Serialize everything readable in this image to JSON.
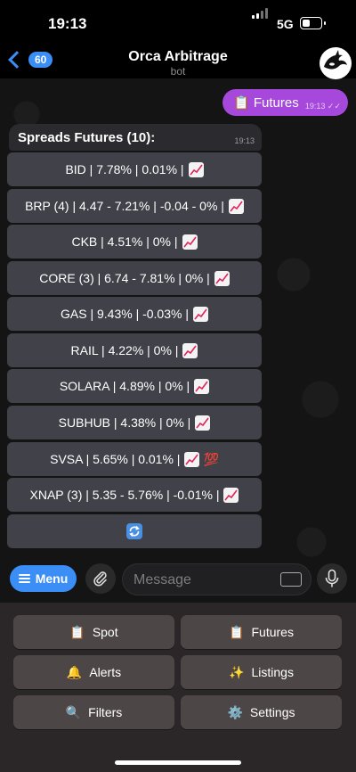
{
  "status": {
    "time": "19:13",
    "network": "5G"
  },
  "header": {
    "back_count": "60",
    "title": "Orca Arbitrage",
    "subtitle": "bot"
  },
  "outgoing": {
    "text": "Futures",
    "time": "19:13"
  },
  "incoming": {
    "text": "Spreads Futures (10):",
    "time": "19:13"
  },
  "inline_buttons": [
    {
      "label": "BID | 7.78% | 0.01% |",
      "icon": "chart-increasing-icon",
      "extra": ""
    },
    {
      "label": "BRP (4) | 4.47 - 7.21% | -0.04 - 0% |",
      "icon": "chart-increasing-icon",
      "extra": ""
    },
    {
      "label": "CKB | 4.51% | 0% |",
      "icon": "chart-increasing-icon",
      "extra": ""
    },
    {
      "label": "CORE (3) | 6.74 - 7.81% | 0% |",
      "icon": "chart-increasing-icon",
      "extra": ""
    },
    {
      "label": "GAS | 9.43% | -0.03% |",
      "icon": "chart-increasing-icon",
      "extra": ""
    },
    {
      "label": "RAIL | 4.22% | 0% |",
      "icon": "chart-increasing-icon",
      "extra": ""
    },
    {
      "label": "SOLARA | 4.89% | 0% |",
      "icon": "chart-increasing-icon",
      "extra": ""
    },
    {
      "label": "SUBHUB | 4.38% | 0% |",
      "icon": "chart-increasing-icon",
      "extra": ""
    },
    {
      "label": "SVSA | 5.65% | 0.01% |",
      "icon": "chart-increasing-icon",
      "extra": "💯"
    },
    {
      "label": "XNAP (3) | 5.35 - 5.76% | -0.01% |",
      "icon": "chart-increasing-icon",
      "extra": ""
    }
  ],
  "refresh_icon": "refresh-icon",
  "input": {
    "menu_label": "Menu",
    "placeholder": "Message"
  },
  "keyboard": {
    "spot": "Spot",
    "futures": "Futures",
    "alerts": "Alerts",
    "listings": "Listings",
    "filters": "Filters",
    "settings": "Settings"
  },
  "colors": {
    "accent": "#3a8ef5",
    "outgoing_bubble": "#a648dc",
    "keyboard_bg": "#2b2627"
  }
}
